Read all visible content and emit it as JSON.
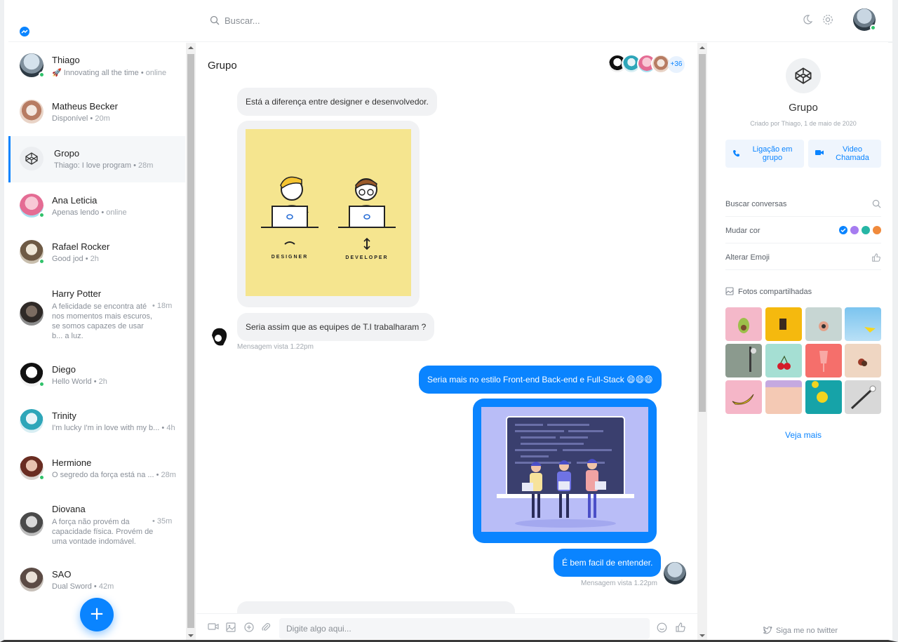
{
  "header": {
    "search_placeholder": "Buscar..."
  },
  "contacts": [
    {
      "name": "Thiago",
      "status": "🚀 Innovating all the time",
      "time": "online",
      "online": true
    },
    {
      "name": "Matheus Becker",
      "status": "Disponível",
      "time": "20m",
      "online": false
    },
    {
      "name": "Gropo",
      "status": "Thiago: I love program",
      "time": "28m",
      "online": false,
      "active": true
    },
    {
      "name": "Ana Leticia",
      "status": "Apenas lendo",
      "time": "online",
      "online": true
    },
    {
      "name": "Rafael Rocker",
      "status": "Good jod",
      "time": "2h",
      "online": true
    },
    {
      "name": "Harry Potter",
      "status": "A felicidade se encontra até nos momentos mais escuros, se somos capazes de usar b... a luz.",
      "time": "18m",
      "online": false
    },
    {
      "name": "Diego",
      "status": "Hello World",
      "time": "2h",
      "online": true
    },
    {
      "name": "Trinity",
      "status": "I'm lucky I'm in love with my b...",
      "time": "4h",
      "online": false
    },
    {
      "name": "Hermione",
      "status": "O segredo da força está na ...",
      "time": "28m",
      "online": true
    },
    {
      "name": "Diovana",
      "status": "A força não provém da capacidade física. Provém de uma vontade indomável.",
      "time": "35m",
      "online": false
    },
    {
      "name": "SAO",
      "status": "Dual Sword",
      "time": "42m",
      "online": false
    }
  ],
  "fab_label": "+",
  "chat": {
    "title": "Grupo",
    "members_more": "+36",
    "messages": {
      "m1": "Está a diferença entre designer e desenvolvedor.",
      "img1_designer": "DESIGNER",
      "img1_developer": "DEVELOPER",
      "m2": "Seria assim que as equipes de T.I trabalharam ?",
      "m2_seen": "Mensagem vista 1.22pm",
      "m3": "Seria mais no estilo Front-end Back-end e Full-Stack 😄😄😄",
      "m4": "É bem facil de entender.",
      "m4_seen": "Mensagem vista 1.22pm"
    },
    "composer_placeholder": "Digite algo aqui..."
  },
  "details": {
    "group_name": "Grupo",
    "created": "Criado por Thiago, 1 de maio de 2020",
    "call_label": "Ligação em grupo",
    "video_label": "Video Chamada",
    "search_conv": "Buscar conversas",
    "change_color": "Mudar cor",
    "colors": [
      "#0a84ff",
      "#a67cf0",
      "#26b6a5",
      "#f08a3c"
    ],
    "change_emoji": "Alterar Emoji",
    "shared_photos": "Fotos compartilhadas",
    "see_more": "Veja mais",
    "twitter": "Siga me no twitter"
  }
}
